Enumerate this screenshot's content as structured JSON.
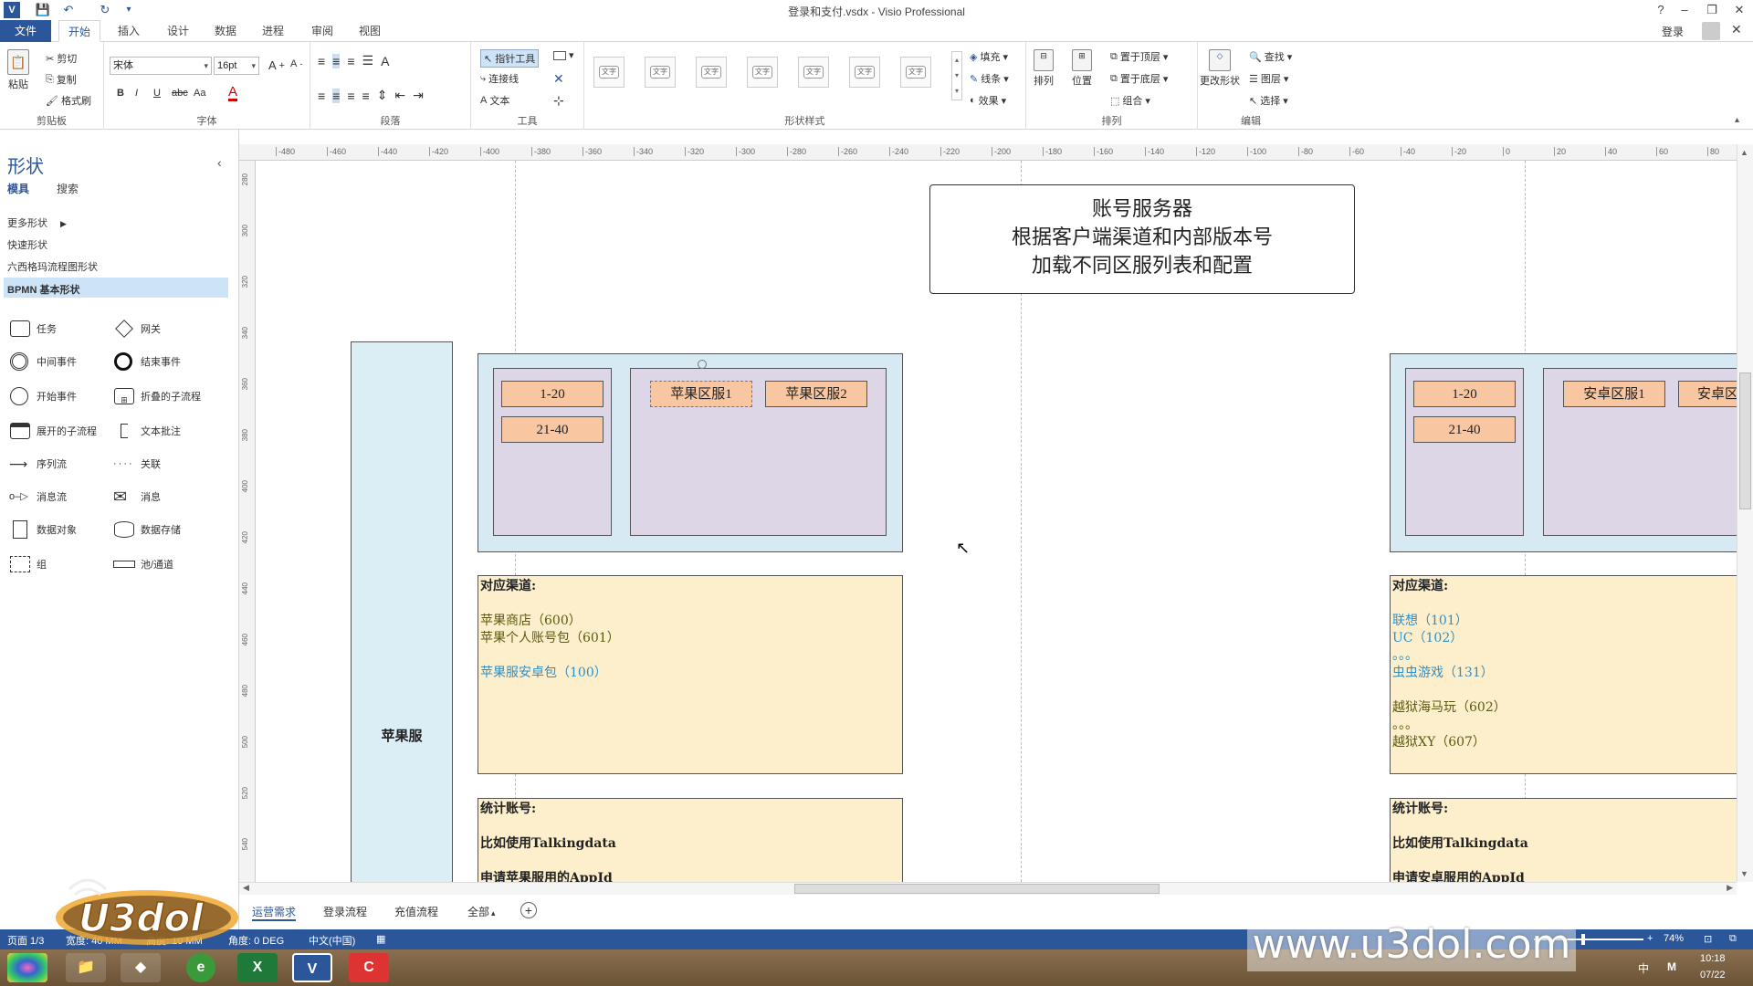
{
  "window": {
    "title": "登录和支付.vsdx - Visio Professional",
    "login": "登录",
    "help": "?",
    "minimize": "–",
    "restore": "❐",
    "close": "✕"
  },
  "tabs": [
    "文件",
    "开始",
    "插入",
    "设计",
    "数据",
    "进程",
    "审阅",
    "视图"
  ],
  "ribbon": {
    "clipboard": {
      "paste": "粘贴",
      "cut": "剪切",
      "copy": "复制",
      "format_painter": "格式刷",
      "label": "剪贴板"
    },
    "font": {
      "family": "宋体",
      "size": "16pt",
      "bold": "B",
      "italic": "I",
      "underline": "U",
      "strike": "abc",
      "case": "Aa",
      "color": "A",
      "label": "字体"
    },
    "paragraph": {
      "label": "段落"
    },
    "tools": {
      "pointer": "指针工具",
      "connector": "连接线",
      "text": "文本",
      "label": "工具"
    },
    "shape_styles": {
      "swatch_text": "文字",
      "fill": "填充",
      "line": "线条",
      "effects": "效果",
      "label": "形状样式"
    },
    "arrange": {
      "align": "排列",
      "position": "位置",
      "bring_front": "置于顶层",
      "send_back": "置于底层",
      "group": "组合",
      "label": "排列"
    },
    "editing": {
      "change_shape": "更改形状",
      "find": "查找",
      "layers": "图层",
      "select": "选择",
      "label": "编辑"
    }
  },
  "shapes_pane": {
    "title": "形状",
    "tab_stencils": "模具",
    "tab_search": "搜索",
    "links": [
      "更多形状",
      "快速形状",
      "六西格玛流程图形状"
    ],
    "active_stencil": "BPMN 基本形状",
    "shapes": [
      {
        "label": "任务",
        "icon": "task-icon"
      },
      {
        "label": "网关",
        "icon": "gateway-icon"
      },
      {
        "label": "中间事件",
        "icon": "intermediate-event-icon"
      },
      {
        "label": "结束事件",
        "icon": "end-event-icon"
      },
      {
        "label": "开始事件",
        "icon": "start-event-icon"
      },
      {
        "label": "折叠的子流程",
        "icon": "collapsed-subprocess-icon"
      },
      {
        "label": "展开的子流程",
        "icon": "expanded-subprocess-icon"
      },
      {
        "label": "文本批注",
        "icon": "text-annotation-icon"
      },
      {
        "label": "序列流",
        "icon": "sequence-flow-icon"
      },
      {
        "label": "关联",
        "icon": "association-icon"
      },
      {
        "label": "消息流",
        "icon": "message-flow-icon"
      },
      {
        "label": "消息",
        "icon": "message-icon"
      },
      {
        "label": "数据对象",
        "icon": "data-object-icon"
      },
      {
        "label": "数据存储",
        "icon": "data-store-icon"
      },
      {
        "label": "组",
        "icon": "group-icon"
      },
      {
        "label": "池/通道",
        "icon": "pool-lane-icon"
      }
    ]
  },
  "ruler": {
    "h_ticks": [
      "-480",
      "-460",
      "-440",
      "-420",
      "-400",
      "-380",
      "-360",
      "-340",
      "-320",
      "-300",
      "-280",
      "-260",
      "-240",
      "-220",
      "-200",
      "-180",
      "-160",
      "-140",
      "-120",
      "-100",
      "-80",
      "-60",
      "-40",
      "-20",
      "0",
      "20",
      "40",
      "60",
      "80"
    ],
    "v_ticks": [
      "280",
      "300",
      "320",
      "340",
      "360",
      "380",
      "400",
      "420",
      "440",
      "460",
      "480",
      "500",
      "520",
      "540"
    ]
  },
  "diagram": {
    "server_box": [
      "账号服务器",
      "根据客户端渠道和内部版本号",
      "加载不同区服列表和配置"
    ],
    "lane_label": "苹果服",
    "apple": {
      "ranges": [
        "1-20",
        "21-40"
      ],
      "servers": [
        "苹果区服1",
        "苹果区服2"
      ],
      "channels_title": "对应渠道:",
      "channels": [
        {
          "text": "苹果商店（600）",
          "style": "olive"
        },
        {
          "text": "苹果个人账号包（601）",
          "style": "olive"
        },
        {
          "text": "",
          "style": "olive"
        },
        {
          "text": "苹果服安卓包（100）",
          "style": "blue"
        }
      ],
      "stats_title": "统计账号:",
      "stats_lines": [
        "比如使用Talkingdata",
        "申请苹果服用的AppId"
      ]
    },
    "android": {
      "ranges": [
        "1-20",
        "21-40"
      ],
      "servers": [
        "安卓区服1",
        "安卓区"
      ],
      "channels_title": "对应渠道:",
      "channels": [
        {
          "text": "联想（101）",
          "style": "blue"
        },
        {
          "text": "UC（102）",
          "style": "blue"
        },
        {
          "text": "。。。",
          "style": "blue"
        },
        {
          "text": "虫虫游戏（131）",
          "style": "blue"
        },
        {
          "text": "",
          "style": "blue"
        },
        {
          "text": "越狱海马玩（602）",
          "style": "olive"
        },
        {
          "text": "。。。",
          "style": "olive"
        },
        {
          "text": "越狱XY（607）",
          "style": "olive"
        }
      ],
      "stats_title": "统计账号:",
      "stats_lines": [
        "比如使用Talkingdata",
        "申请安卓服用的AppId"
      ]
    }
  },
  "page_tabs": [
    "运营需求",
    "登录流程",
    "充值流程",
    "全部"
  ],
  "status_bar": {
    "page": "页面 1/3",
    "width": "宽度: 40 MM",
    "height": "高度: 10 MM",
    "angle": "角度: 0 DEG",
    "language": "中文(中国)",
    "zoom": "74%"
  },
  "taskbar": {
    "ime": "中",
    "ime2": "M",
    "time": "10:18",
    "date": "07/22"
  },
  "watermark": "www.u3dol.com",
  "logo_text": "U3dol"
}
